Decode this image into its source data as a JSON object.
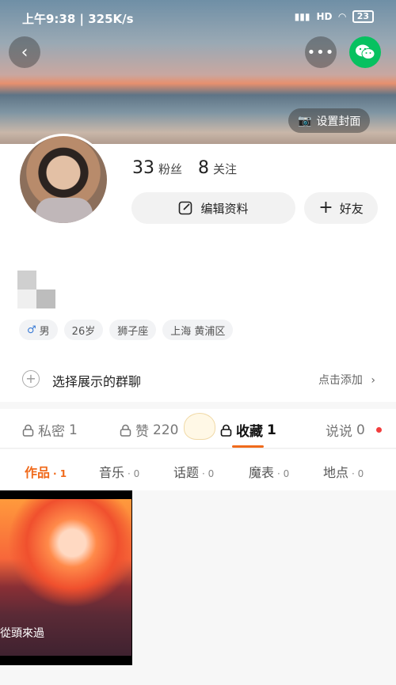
{
  "status_bar": {
    "time_text": "上午9:38 | 325K/s",
    "network": "HD",
    "battery": "23"
  },
  "header": {
    "set_cover_label": "设置封面"
  },
  "profile": {
    "fans_count": "33",
    "fans_label": "粉丝",
    "following_count": "8",
    "following_label": "关注",
    "edit_label": "编辑资料",
    "friend_label": "好友"
  },
  "tags": [
    "男",
    "26岁",
    "狮子座",
    "上海 黄浦区"
  ],
  "group": {
    "label": "选择展示的群聊",
    "add_label": "点击添加"
  },
  "tabs": [
    {
      "label": "私密",
      "count": "1",
      "locked": true
    },
    {
      "label": "赞",
      "count": "220",
      "locked": true
    },
    {
      "label": "收藏",
      "count": "1",
      "locked": true,
      "active": true
    },
    {
      "label": "说说",
      "count": "0",
      "locked": false
    }
  ],
  "subtabs": [
    {
      "label": "作品",
      "count": "· 1",
      "active": true
    },
    {
      "label": "音乐",
      "count": "· 0"
    },
    {
      "label": "话题",
      "count": "· 0"
    },
    {
      "label": "魔表",
      "count": "· 0"
    },
    {
      "label": "地点",
      "count": "· 0"
    }
  ],
  "works": [
    {
      "caption": "從頭來過"
    }
  ],
  "colors": {
    "accent": "#f06a1b",
    "wechat": "#07c160",
    "dot": "#f23d3d"
  }
}
